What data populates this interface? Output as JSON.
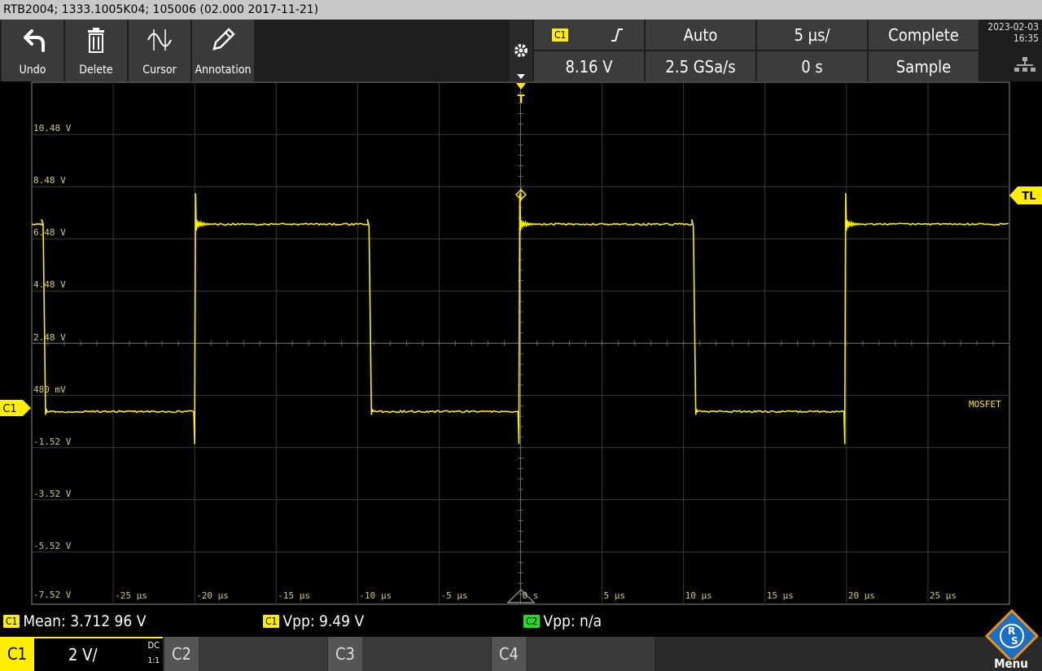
{
  "window": {
    "title": "RTB2004; 1333.1005K04; 105006 (02.000 2017-11-21)"
  },
  "toolbar": {
    "tools": [
      {
        "label": "Undo",
        "icon": "undo-icon"
      },
      {
        "label": "Delete",
        "icon": "trash-icon"
      },
      {
        "label": "Cursor",
        "icon": "cursor-wave-icon"
      },
      {
        "label": "Annotation",
        "icon": "pencil-icon"
      }
    ]
  },
  "acquisition": {
    "channel_badge": "C1",
    "trigger_mode": "Auto",
    "timebase": "5 µs/",
    "status": "Complete",
    "trigger_level": "8.16 V",
    "sample_rate": "2.5 GSa/s",
    "horizontal_position": "0 s",
    "acq_mode": "Sample",
    "date": "2023-02-03",
    "time": "16:35"
  },
  "waveform": {
    "volt_labels": [
      "10.48 V",
      "8.48 V",
      "6.48 V",
      "4.48 V",
      "2.48 V",
      "480 mV",
      "-1.52 V",
      "-3.52 V",
      "-5.52 V",
      "-7.52 V"
    ],
    "time_labels": [
      "-25 µs",
      "-20 µs",
      "-15 µs",
      "-10 µs",
      "-5 µs",
      "0 s",
      "5 µs",
      "10 µs",
      "15 µs",
      "20 µs",
      "25 µs"
    ],
    "channel_label": "C1",
    "trigger_level_marker": "TL",
    "trigger_marker": "T",
    "trace_label": "MOSFET",
    "trace_color": "#ffee00",
    "high_level_v": 6.48,
    "low_level_v": -0.7
  },
  "measurements": [
    {
      "badge": "C1",
      "text": "Mean: 3.712 96 V",
      "color": "#ffee00"
    },
    {
      "badge": "C1",
      "text": "Vpp: 9.49 V",
      "color": "#ffee00"
    },
    {
      "badge": "C2",
      "text": "Vpp: n/a",
      "color": "#22dd22"
    }
  ],
  "channels": [
    {
      "name": "C1",
      "scale": "2 V/",
      "coupling": "DC",
      "probe": "1:1",
      "active": true
    },
    {
      "name": "C2",
      "active": false
    },
    {
      "name": "C3",
      "active": false
    },
    {
      "name": "C4",
      "active": false
    }
  ],
  "menu": {
    "label": "Menu"
  },
  "colors": {
    "accent": "#ffee00",
    "c2": "#22dd22",
    "panel": "#3c3c3c"
  }
}
